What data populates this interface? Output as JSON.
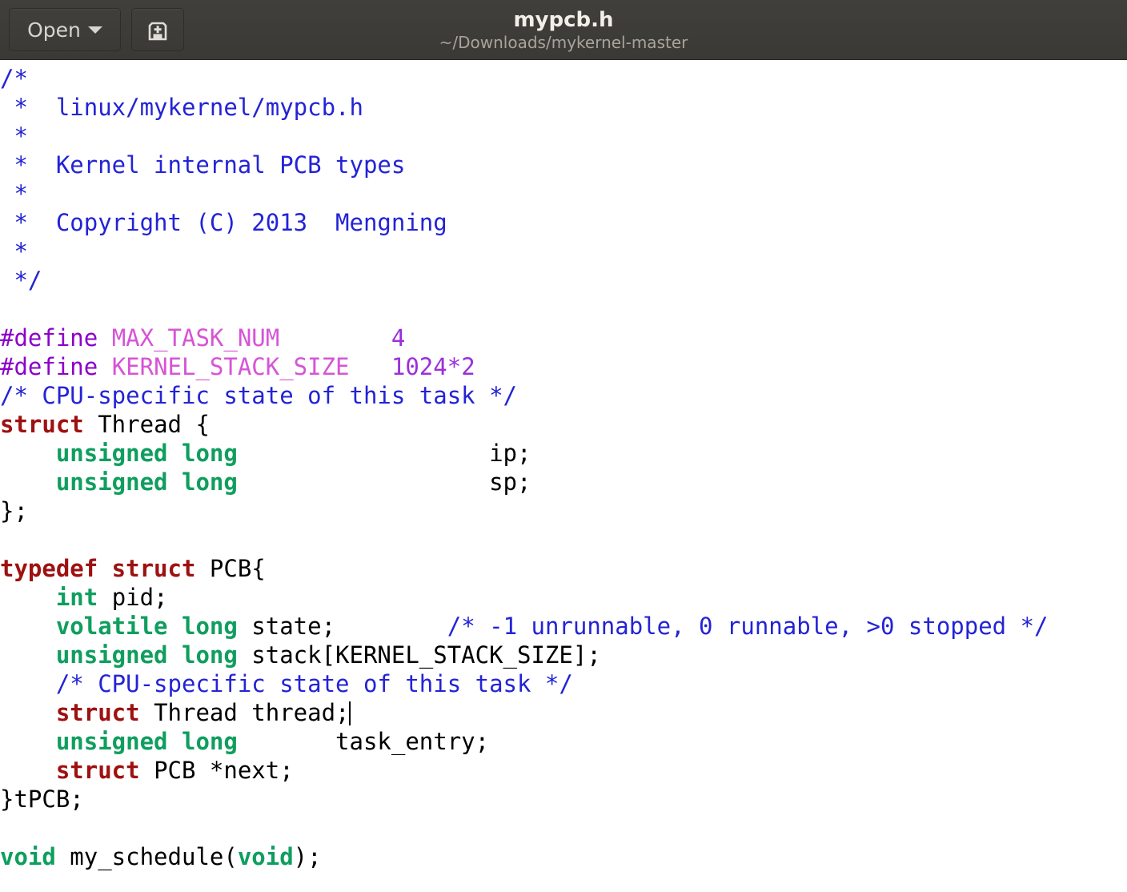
{
  "window": {
    "title": "mypcb.h",
    "subtitle": "~/Downloads/mykernel-master"
  },
  "toolbar": {
    "open_label": "Open",
    "open_dropdown_icon": "chevron-down-icon",
    "new_document_icon": "new-document-icon"
  },
  "colors": {
    "headerbar_bg": "#3c3b37",
    "editor_bg": "#ffffff",
    "comment": "#2323d6",
    "preprocessor": "#8c00c8",
    "macro_name": "#d654d6",
    "number": "#9b30d9",
    "keyword": "#9e1111",
    "type": "#0f9e5e",
    "plain_text": "#000000"
  },
  "editor": {
    "language": "c-header",
    "cursor_line": 25,
    "lines": [
      {
        "n": 1,
        "tokens": [
          {
            "t": "comment",
            "s": "/*"
          }
        ]
      },
      {
        "n": 2,
        "tokens": [
          {
            "t": "comment",
            "s": " *  linux/mykernel/mypcb.h"
          }
        ]
      },
      {
        "n": 3,
        "tokens": [
          {
            "t": "comment",
            "s": " *"
          }
        ]
      },
      {
        "n": 4,
        "tokens": [
          {
            "t": "comment",
            "s": " *  Kernel internal PCB types"
          }
        ]
      },
      {
        "n": 5,
        "tokens": [
          {
            "t": "comment",
            "s": " *"
          }
        ]
      },
      {
        "n": 6,
        "tokens": [
          {
            "t": "comment",
            "s": " *  Copyright (C) 2013  Mengning"
          }
        ]
      },
      {
        "n": 7,
        "tokens": [
          {
            "t": "comment",
            "s": " *"
          }
        ]
      },
      {
        "n": 8,
        "tokens": [
          {
            "t": "comment",
            "s": " */"
          }
        ]
      },
      {
        "n": 9,
        "tokens": []
      },
      {
        "n": 10,
        "tokens": [
          {
            "t": "preproc",
            "s": "#define "
          },
          {
            "t": "macro",
            "s": "MAX_TASK_NUM"
          },
          {
            "t": "plain",
            "s": "        "
          },
          {
            "t": "number",
            "s": "4"
          }
        ]
      },
      {
        "n": 11,
        "tokens": [
          {
            "t": "preproc",
            "s": "#define "
          },
          {
            "t": "macro",
            "s": "KERNEL_STACK_SIZE"
          },
          {
            "t": "plain",
            "s": "   "
          },
          {
            "t": "number",
            "s": "1024*2"
          }
        ]
      },
      {
        "n": 12,
        "tokens": [
          {
            "t": "comment",
            "s": "/* CPU-specific state of this task */"
          }
        ]
      },
      {
        "n": 13,
        "tokens": [
          {
            "t": "kw",
            "s": "struct"
          },
          {
            "t": "plain",
            "s": " Thread {"
          }
        ]
      },
      {
        "n": 14,
        "tokens": [
          {
            "t": "plain",
            "s": "    "
          },
          {
            "t": "type",
            "s": "unsigned long"
          },
          {
            "t": "plain",
            "s": "                  ip;"
          }
        ]
      },
      {
        "n": 15,
        "tokens": [
          {
            "t": "plain",
            "s": "    "
          },
          {
            "t": "type",
            "s": "unsigned long"
          },
          {
            "t": "plain",
            "s": "                  sp;"
          }
        ]
      },
      {
        "n": 16,
        "tokens": [
          {
            "t": "plain",
            "s": "};"
          }
        ]
      },
      {
        "n": 17,
        "tokens": []
      },
      {
        "n": 18,
        "tokens": [
          {
            "t": "kw",
            "s": "typedef struct"
          },
          {
            "t": "plain",
            "s": " PCB{"
          }
        ]
      },
      {
        "n": 19,
        "tokens": [
          {
            "t": "plain",
            "s": "    "
          },
          {
            "t": "type",
            "s": "int"
          },
          {
            "t": "plain",
            "s": " pid;"
          }
        ]
      },
      {
        "n": 20,
        "tokens": [
          {
            "t": "plain",
            "s": "    "
          },
          {
            "t": "type",
            "s": "volatile long"
          },
          {
            "t": "plain",
            "s": " state;        "
          },
          {
            "t": "comment",
            "s": "/* -1 unrunnable, 0 runnable, >0 stopped */"
          }
        ]
      },
      {
        "n": 21,
        "tokens": [
          {
            "t": "plain",
            "s": "    "
          },
          {
            "t": "type",
            "s": "unsigned long"
          },
          {
            "t": "plain",
            "s": " stack[KERNEL_STACK_SIZE];"
          }
        ]
      },
      {
        "n": 22,
        "tokens": [
          {
            "t": "plain",
            "s": "    "
          },
          {
            "t": "comment",
            "s": "/* CPU-specific state of this task */"
          }
        ]
      },
      {
        "n": 23,
        "tokens": [
          {
            "t": "plain",
            "s": "    "
          },
          {
            "t": "kw",
            "s": "struct"
          },
          {
            "t": "plain",
            "s": " Thread thread;"
          },
          {
            "t": "caret",
            "s": ""
          }
        ]
      },
      {
        "n": 24,
        "tokens": [
          {
            "t": "plain",
            "s": "    "
          },
          {
            "t": "type",
            "s": "unsigned long"
          },
          {
            "t": "plain",
            "s": "       task_entry;"
          }
        ]
      },
      {
        "n": 25,
        "tokens": [
          {
            "t": "plain",
            "s": "    "
          },
          {
            "t": "kw",
            "s": "struct"
          },
          {
            "t": "plain",
            "s": " PCB *next;"
          }
        ]
      },
      {
        "n": 26,
        "tokens": [
          {
            "t": "plain",
            "s": "}tPCB;"
          }
        ]
      },
      {
        "n": 27,
        "tokens": []
      },
      {
        "n": 28,
        "tokens": [
          {
            "t": "type",
            "s": "void"
          },
          {
            "t": "plain",
            "s": " my_schedule("
          },
          {
            "t": "type",
            "s": "void"
          },
          {
            "t": "plain",
            "s": ");"
          }
        ]
      }
    ]
  }
}
